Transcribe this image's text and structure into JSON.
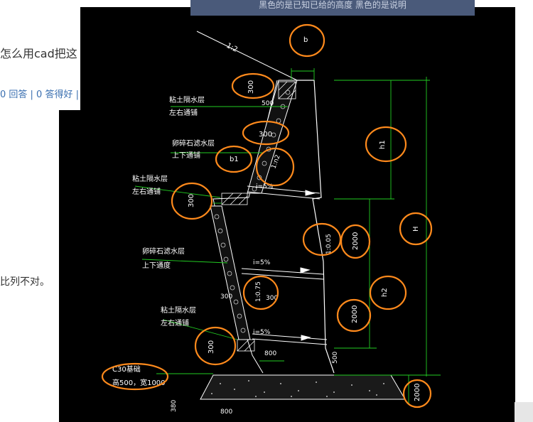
{
  "background": {
    "question_title": "怎么用cad把这",
    "answer_meta": "0 回答 | 0 答得好 |",
    "body_text": "比列不对。"
  },
  "overlay": {
    "title_bar": "黑色的是已知已给的高度 黑色的是说明"
  },
  "drawing": {
    "slope_top": "1:2",
    "labels": {
      "clay1_a": "粘土隔水层",
      "clay1_b": "左右通铺",
      "gravel1_a": "卵碎石滤水层",
      "gravel1_b": "上下通铺",
      "clay2_a": "粘土隔水层",
      "clay2_b": "左右通铺",
      "gravel2_a": "卵碎石滤水层",
      "gravel2_b": "上下通度",
      "clay3_a": "粘土隔水层",
      "clay3_b": "左右通铺",
      "base_a": "C30基础",
      "base_b": "高500，宽1000"
    },
    "dims": {
      "d300a": "300",
      "d500": "500",
      "d300b": "300",
      "d300c": "300",
      "d300d": "300",
      "d300e": "300",
      "d800": "800",
      "d800b": "800",
      "d500b": "500",
      "d300f": "300",
      "d380": "380",
      "d2000a": "2000",
      "d2000b": "2000",
      "d2000c": "2000",
      "slope1": "1:n2",
      "slope2": "1:0.05",
      "slope3": "1:0.75",
      "grad1": "i=5%",
      "grad2": "i=5%",
      "grad3": "i=5%"
    },
    "annotations": {
      "b": "b",
      "b1": "b1",
      "h1": "h1",
      "H": "H",
      "h2": "h2",
      "a300": "300",
      "a300b": "300",
      "a300c": "300",
      "a2000": "2000",
      "a2000b": "2000",
      "a2000c": "2000"
    }
  },
  "colors": {
    "canvas": "#000000",
    "linework": "#ffffff",
    "dimension": "#22cc22",
    "annotation": "#ff8a1c"
  }
}
